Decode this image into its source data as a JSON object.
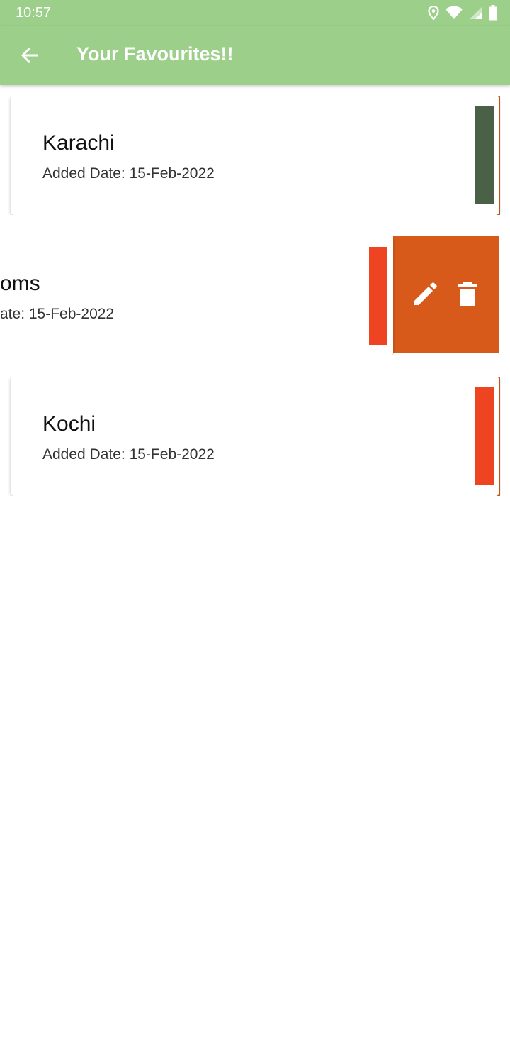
{
  "status_bar": {
    "time": "10:57",
    "icons": [
      "location-icon",
      "wifi-icon",
      "signal-icon",
      "battery-icon"
    ]
  },
  "app_bar": {
    "title": "Your Favourites!!",
    "back_icon": "arrow-back-icon",
    "background": "#9ccf8a"
  },
  "favourites": [
    {
      "name": "Karachi",
      "added_date": "Added Date: 15-Feb-2022",
      "color": "#4a6148"
    },
    {
      "name": "oms",
      "added_date": "ate: 15-Feb-2022",
      "color": "#ef4422",
      "swiped": true
    },
    {
      "name": "Kochi",
      "added_date": "Added Date: 15-Feb-2022",
      "color": "#ef4422"
    }
  ],
  "swipe_actions": {
    "background": "#d85a1a",
    "edit_icon": "pencil-icon",
    "delete_icon": "trash-icon"
  }
}
